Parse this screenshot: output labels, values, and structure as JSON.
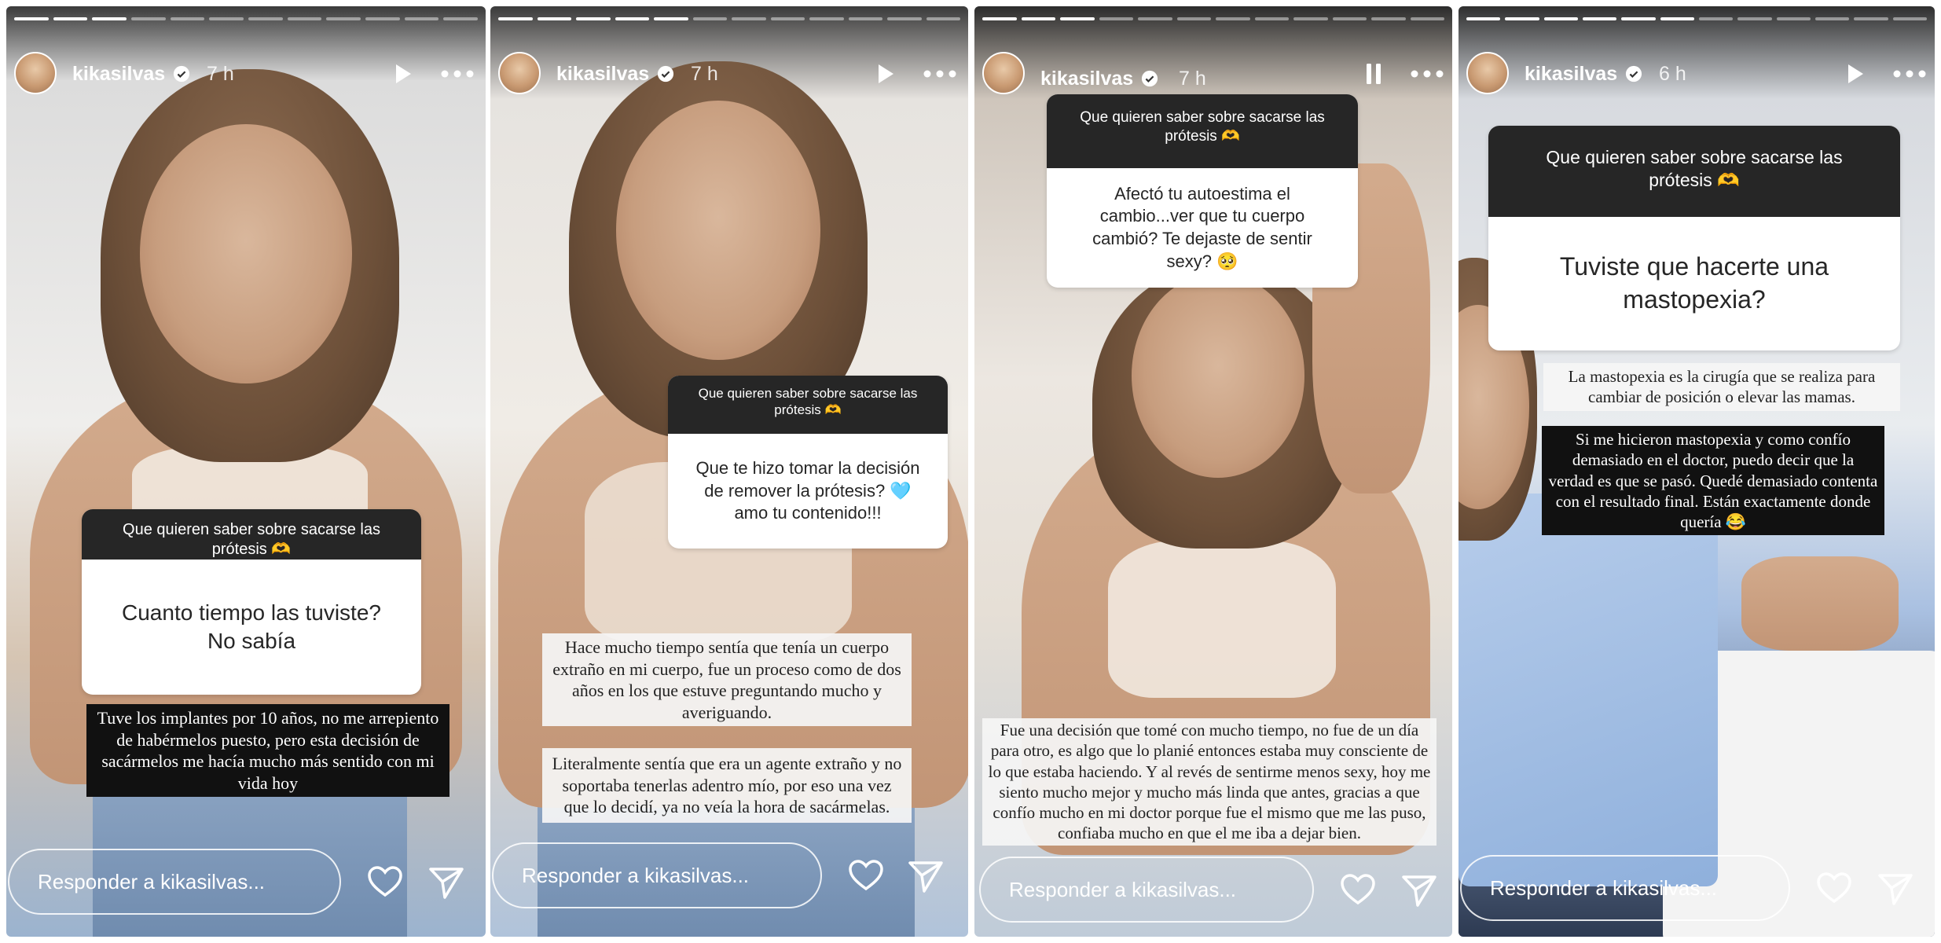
{
  "stories": [
    {
      "username": "kikasilvas",
      "time": "7 h",
      "state_icon": "play-icon",
      "question_header": "Que quieren saber sobre sacarse las prótesis 🫶",
      "question_text": "Cuanto tiempo las tuviste? No sabía",
      "captions": [
        "Tuve los implantes por 10 años, no me arrepiento de habérmelos puesto, pero esta decisión de sacármelos me hacía mucho más sentido con mi vida hoy"
      ],
      "reply_placeholder": "Responder a kikasilvas..."
    },
    {
      "username": "kikasilvas",
      "time": "7 h",
      "state_icon": "play-icon",
      "question_header": "Que quieren saber sobre sacarse las prótesis 🫶",
      "question_text": "Que te hizo tomar la decisión de remover la prótesis? 🩵 amo tu contenido!!!",
      "captions": [
        "Hace mucho tiempo sentía que tenía un cuerpo extraño en mi cuerpo, fue un proceso como de dos años en los que estuve preguntando mucho y averiguando.",
        "Literalmente sentía que era un agente extraño y no soportaba tenerlas adentro mío, por eso una vez que lo decidí, ya no veía la hora de sacármelas."
      ],
      "reply_placeholder": "Responder a kikasilvas..."
    },
    {
      "username": "kikasilvas",
      "time": "7 h",
      "state_icon": "pause-icon",
      "question_header": "Que quieren saber sobre sacarse las prótesis 🫶",
      "question_text": "Afectó tu autoestima el cambio...ver que tu cuerpo cambió? Te dejaste de sentir sexy? 🥺",
      "captions": [
        "Fue una decisión que tomé con mucho tiempo, no fue de un día para otro, es algo que lo planié entonces estaba muy consciente de lo que estaba haciendo. Y al revés de sentirme menos sexy, hoy me siento mucho mejor y mucho más linda que antes, gracias a que confío mucho en mi doctor porque fue el mismo que me las puso, confiaba mucho en que el me iba a dejar bien."
      ],
      "reply_placeholder": "Responder a kikasilvas..."
    },
    {
      "username": "kikasilvas",
      "time": "6 h",
      "state_icon": "play-icon",
      "question_header": "Que quieren saber sobre sacarse las prótesis 🫶",
      "question_text": "Tuviste que hacerte una mastopexia?",
      "captions": [
        "La mastopexia es la cirugía que se realiza para cambiar de posición o elevar las mamas.",
        "Si me hicieron mastopexia y como confío demasiado en el doctor, puedo decir que la verdad es que se pasó. Quedé demasiado contenta con el resultado final. Están exactamente donde quería 😂"
      ],
      "reply_placeholder": "Responder a kikasilvas..."
    }
  ],
  "colors": {
    "question_header_bg": "#262626",
    "caption_dark_bg": "#111111",
    "verified_blue": "#ffffff"
  }
}
